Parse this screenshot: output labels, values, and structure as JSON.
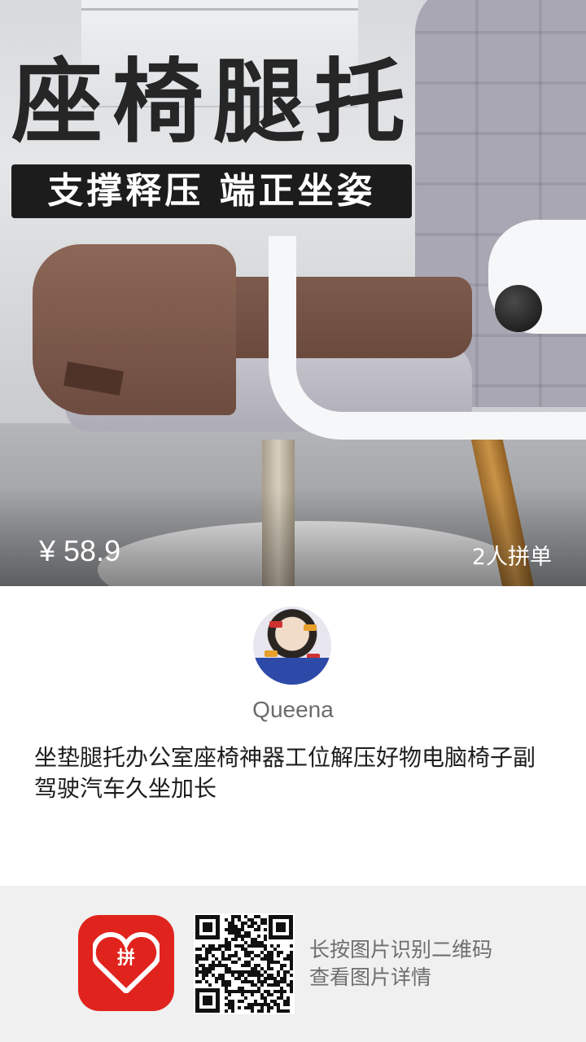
{
  "product": {
    "hero_title": "座椅腿托",
    "hero_banner": "支撑释压  端正坐姿",
    "price": "¥ 58.9",
    "group_buy": "2人拼单",
    "title": "坐垫腿托办公室座椅神器工位解压好物电脑椅子副驾驶汽车久坐加长"
  },
  "user": {
    "name": "Queena"
  },
  "footer": {
    "hint_line1": "长按图片识别二维码",
    "hint_line2": "查看图片详情",
    "logo_char": "拼"
  },
  "icons": {
    "app_logo": "pinduoduo-logo-icon",
    "qr": "qr-code-icon"
  },
  "colors": {
    "brand": "#e0241d",
    "footer_bg": "#f0f0f0"
  }
}
